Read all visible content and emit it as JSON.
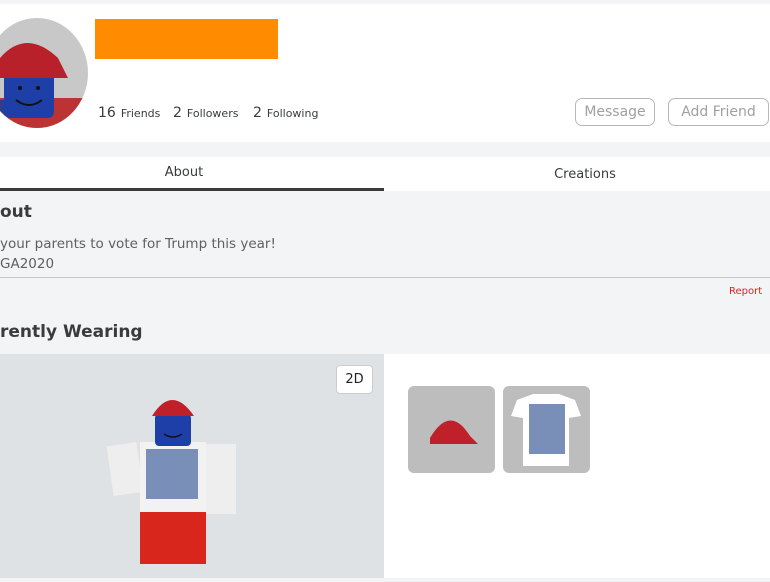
{
  "profile": {
    "name_redacted_color": "#ff8c00",
    "friends_count": "16",
    "friends_label": "Friends",
    "followers_count": "2",
    "followers_label": "Followers",
    "following_count": "2",
    "following_label": "Following"
  },
  "actions": {
    "message": "Message",
    "add_friend": "Add Friend"
  },
  "tabs": [
    {
      "label": "About",
      "active": true
    },
    {
      "label": "Creations",
      "active": false
    }
  ],
  "about": {
    "heading": "out",
    "bio_line1": "your parents to vote for Trump this year!",
    "bio_line2": "GA2020",
    "report": "Report"
  },
  "wearing": {
    "heading": "rently Wearing",
    "toggle": "2D",
    "items": [
      "hat-icon",
      "shirt-icon"
    ]
  }
}
